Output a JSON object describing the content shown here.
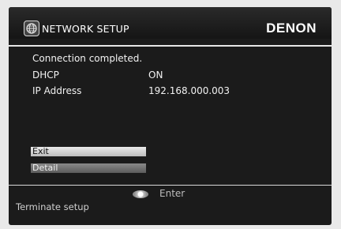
{
  "header": {
    "title": "NETWORK SETUP",
    "brand": "DENON",
    "icon": "network-globe-icon"
  },
  "status": {
    "message": "Connection completed.",
    "dhcp_label": "DHCP",
    "dhcp_value": "ON",
    "ip_label": "IP Address",
    "ip_value": "192.168.000.003"
  },
  "menu": {
    "exit_label": "Exit",
    "detail_label": "Detail",
    "selected": "Exit"
  },
  "footer": {
    "enter_icon": "enter-button-icon",
    "enter_label": "Enter",
    "help_text": "Terminate setup"
  },
  "colors": {
    "background": "#1b1b1b",
    "text": "#f2f2f2",
    "selected_button": "#d9d9d9",
    "button": "#6f6f6f"
  }
}
